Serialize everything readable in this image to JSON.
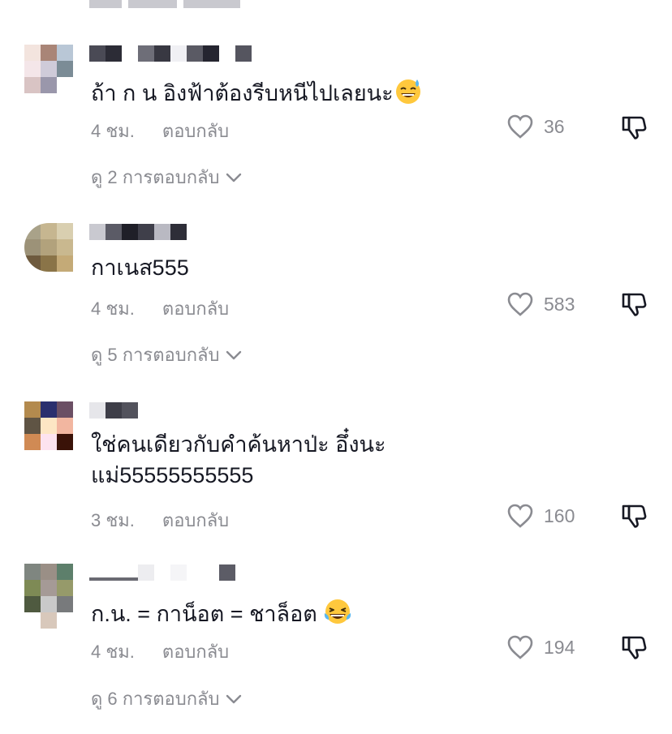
{
  "comments": [
    {
      "text": "ถ้า ก น อิงฟ้าต้องรีบหนีไปเลยนะ",
      "emoji": "sweat-smile-emoji",
      "time": "4 ชม.",
      "reply": "ตอบกลับ",
      "likes": "36",
      "view_replies": "ดู 2 การตอบกลับ"
    },
    {
      "text": "กาเนส555",
      "time": "4 ชม.",
      "reply": "ตอบกลับ",
      "likes": "583",
      "view_replies": "ดู 5 การตอบกลับ"
    },
    {
      "text": "ใช่คนเดียวกับคำค้นหาป่ะ อึ๋งนะ\nแม่55555555555",
      "time": "3 ชม.",
      "reply": "ตอบกลับ",
      "likes": "160"
    },
    {
      "text": "ก.น. = กาน็อต = ชาล็อต",
      "emoji": "laughing-tears-emoji",
      "time": "4 ชม.",
      "reply": "ตอบกลับ",
      "likes": "194",
      "view_replies": "ดู 6 การตอบกลับ"
    }
  ],
  "icons": {
    "like": "heart-outline-icon",
    "dislike": "thumbs-down-outline-icon",
    "expand": "chevron-down-icon"
  },
  "colors": {
    "text": "#161823",
    "muted": "#8a8b91",
    "background": "#ffffff"
  }
}
